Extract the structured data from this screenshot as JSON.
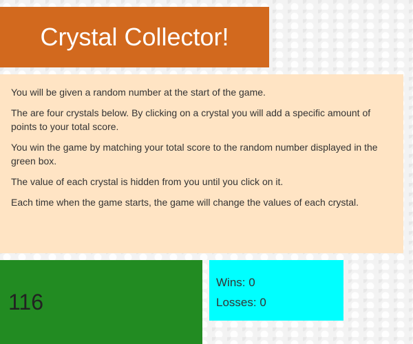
{
  "title": "Crystal Collector!",
  "instructions": [
    "You will be given a random number at the start of the game.",
    "The are four crystals below. By clicking on a crystal you will add a specific amount of points to your total score.",
    "You win the game by matching your total score to the random number displayed in the green box.",
    "The value of each crystal is hidden from you until you click on it.",
    "Each time when the game starts, the game will change the values of each crystal."
  ],
  "target_number": "116",
  "score": {
    "wins_label": "Wins:",
    "wins_value": "0",
    "losses_label": "Losses:",
    "losses_value": "0"
  },
  "colors": {
    "title_bg": "#d2691e",
    "instructions_bg": "#ffe4c4",
    "target_bg": "#228b22",
    "score_bg": "#00ffff"
  }
}
